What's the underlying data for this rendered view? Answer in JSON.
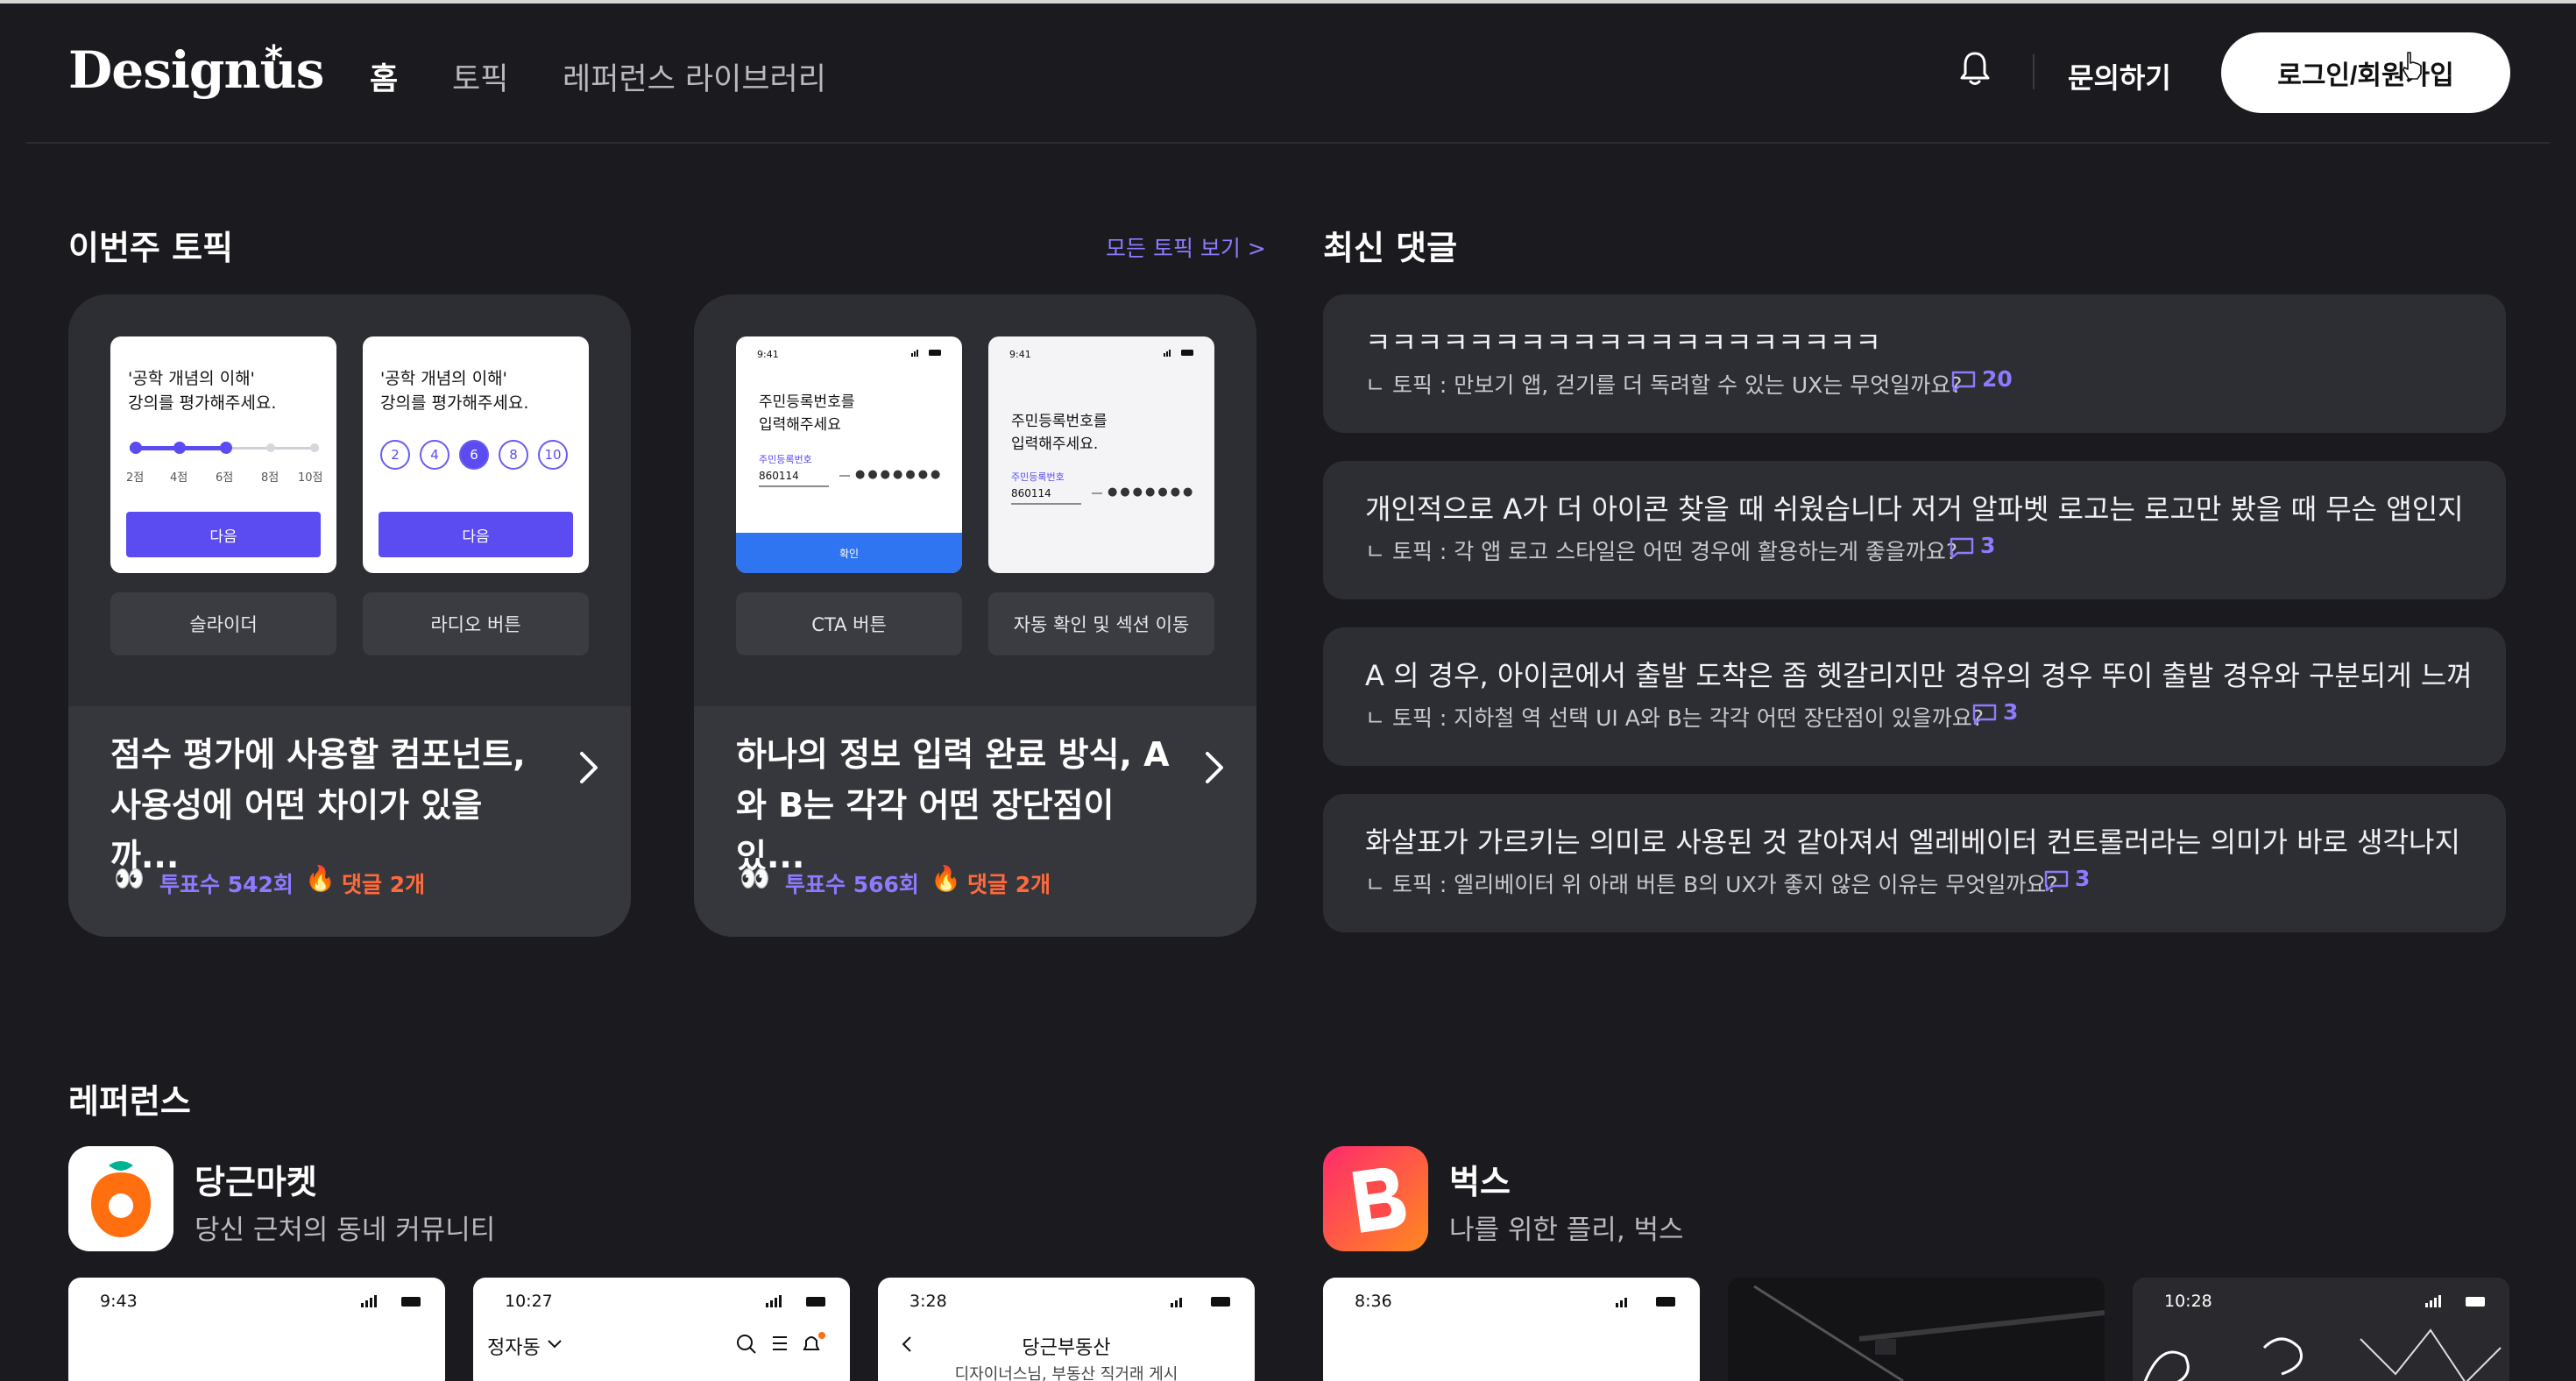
{
  "header": {
    "logo": "Designus",
    "logo_mark": "*",
    "nav": [
      "홈",
      "토픽",
      "레퍼런스 라이브러리"
    ],
    "inquiry": "문의하기",
    "login": "로그인/회원가입"
  },
  "weekly_topics": {
    "title": "이번주 토픽",
    "see_all": "모든 토픽 보기 >",
    "cards": [
      {
        "previews": [
          {
            "question": [
              "'공학 개념의 이해'",
              "강의를 평가해주세요."
            ],
            "slider_labels": [
              "2점",
              "4점",
              "6점",
              "8점",
              "10점"
            ],
            "button": "다음",
            "chip": "슬라이더"
          },
          {
            "question": [
              "'공학 개념의 이해'",
              "강의를 평가해주세요."
            ],
            "radio_options": [
              "2",
              "4",
              "6",
              "8",
              "10"
            ],
            "selected": "6",
            "button": "다음",
            "chip": "라디오 버튼"
          }
        ],
        "title": "점수 평가에 사용할 컴포넌트, 사용성에 어떤 차이가 있을까...",
        "votes": "투표수 542회",
        "comments": "댓글 2개"
      },
      {
        "previews": [
          {
            "time": "9:41",
            "title": [
              "주민등록번호를",
              "입력해주세요"
            ],
            "field_label": "주민등록번호",
            "field_value": "860114",
            "mask": "●●●●●●●",
            "button": "확인",
            "chip": "CTA 버튼"
          },
          {
            "time": "9:41",
            "title": [
              "주민등록번호를",
              "입력해주세요."
            ],
            "field_label": "주민등록번호",
            "field_value": "860114",
            "mask": "●●●●●●●",
            "chip": "자동 확인 및 섹션 이동"
          }
        ],
        "title": "하나의 정보 입력 완료 방식, A와 B는 각각 어떤 장단점이 있...",
        "votes": "투표수 566회",
        "comments": "댓글 2개"
      }
    ]
  },
  "latest_comments": {
    "title": "최신 댓글",
    "items": [
      {
        "text": "ㅋㅋㅋㅋㅋㅋㅋㅋㅋㅋㅋㅋㅋㅋㅋㅋㅋㅋㅋㅋ",
        "topic": "ㄴ 토픽 : 만보기 앱, 걷기를 더 독려할 수 있는 UX는 무엇일까요?",
        "count": "20"
      },
      {
        "text": "개인적으로 A가 더 아이콘 찾을 때 쉬웠습니다 저거 알파벳 로고는 로고만 봤을 때 무슨 앱인지 전혀 ...",
        "topic": "ㄴ 토픽 : 각 앱 로고 스타일은 어떤 경우에 활용하는게 좋을까요?",
        "count": "3"
      },
      {
        "text": "A 의 경우, 아이콘에서 출발 도착은 좀 헷갈리지만 경유의 경우 뚜이 출발 경유와 구분되게 느껴지는 ...",
        "topic": "ㄴ 토픽 : 지하철 역 선택 UI A와 B는 각각 어떤 장단점이 있을까요?",
        "count": "3"
      },
      {
        "text": "화살표가 가르키는 의미로 사용된 것 같아져서 엘레베이터 컨트롤러라는 의미가 바로 생각나지 못하...",
        "topic": "ㄴ 토픽 : 엘리베이터 위 아래 버튼 B의 UX가 좋지 않은 이유는 무엇일까요?",
        "count": "3"
      }
    ]
  },
  "references": {
    "title": "레퍼런스",
    "apps": [
      {
        "name": "당근마켓",
        "desc": "당신 근처의 동네 커뮤니티",
        "shots": [
          {
            "time": "9:43"
          },
          {
            "time": "10:27",
            "location": "정자동"
          },
          {
            "time": "3:28",
            "header": "당근부동산",
            "sub": "디자이너스님, 부동산 직거래 게시"
          }
        ]
      },
      {
        "name": "벅스",
        "desc": "나를 위한 플리, 벅스",
        "shots": [
          {
            "time": "8:36"
          },
          {
            "time": ""
          },
          {
            "time": "10:28"
          }
        ]
      }
    ]
  },
  "colors": {
    "background": "#1b1b1f",
    "card": "#2d2e33",
    "accent": "#8d7bff",
    "button_purple": "#5b4cf2",
    "fire": "#ff6a3d",
    "carrot_orange": "#ff6f0f",
    "bugs_gradient": [
      "#ff2a6d",
      "#ff8a1e"
    ]
  }
}
